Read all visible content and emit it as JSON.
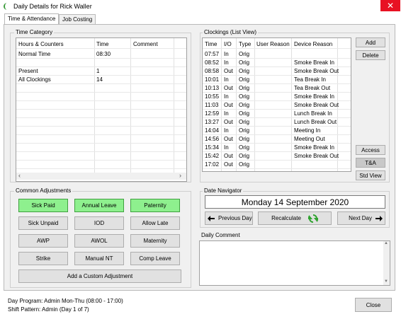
{
  "window": {
    "title": "Daily Details for Rick Waller",
    "close_symbol": "✕"
  },
  "tabs": [
    {
      "label": "Time & Attendance",
      "active": true
    },
    {
      "label": "Job Costing",
      "active": false
    }
  ],
  "time_category": {
    "title": "Time Category",
    "columns": [
      "Hours & Counters",
      "Time",
      "Comment"
    ],
    "rows": [
      {
        "name": "Normal Time",
        "time": "08:30",
        "comment": ""
      },
      {
        "name": "",
        "time": "",
        "comment": ""
      },
      {
        "name": "Present",
        "time": "1",
        "comment": ""
      },
      {
        "name": "All Clockings",
        "time": "14",
        "comment": ""
      }
    ]
  },
  "clockings": {
    "title": "Clockings (List View)",
    "columns": [
      "Time",
      "I/O",
      "Type",
      "User Reason",
      "Device Reason"
    ],
    "rows": [
      {
        "time": "07:57",
        "io": "In",
        "type": "Orig",
        "user_reason": "",
        "device_reason": ""
      },
      {
        "time": "08:52",
        "io": "In",
        "type": "Orig",
        "user_reason": "",
        "device_reason": "Smoke Break In"
      },
      {
        "time": "08:58",
        "io": "Out",
        "type": "Orig",
        "user_reason": "",
        "device_reason": "Smoke Break Out"
      },
      {
        "time": "10:01",
        "io": "In",
        "type": "Orig",
        "user_reason": "",
        "device_reason": "Tea Break In"
      },
      {
        "time": "10:13",
        "io": "Out",
        "type": "Orig",
        "user_reason": "",
        "device_reason": "Tea Break Out"
      },
      {
        "time": "10:55",
        "io": "In",
        "type": "Orig",
        "user_reason": "",
        "device_reason": "Smoke Break In"
      },
      {
        "time": "11:03",
        "io": "Out",
        "type": "Orig",
        "user_reason": "",
        "device_reason": "Smoke Break Out"
      },
      {
        "time": "12:59",
        "io": "In",
        "type": "Orig",
        "user_reason": "",
        "device_reason": "Lunch Break In"
      },
      {
        "time": "13:27",
        "io": "Out",
        "type": "Orig",
        "user_reason": "",
        "device_reason": "Lunch Break Out"
      },
      {
        "time": "14:04",
        "io": "In",
        "type": "Orig",
        "user_reason": "",
        "device_reason": "Meeting In"
      },
      {
        "time": "14:56",
        "io": "Out",
        "type": "Orig",
        "user_reason": "",
        "device_reason": "Meeting Out"
      },
      {
        "time": "15:34",
        "io": "In",
        "type": "Orig",
        "user_reason": "",
        "device_reason": "Smoke Break In"
      },
      {
        "time": "15:42",
        "io": "Out",
        "type": "Orig",
        "user_reason": "",
        "device_reason": "Smoke Break Out"
      },
      {
        "time": "17:02",
        "io": "Out",
        "type": "Orig",
        "user_reason": "",
        "device_reason": ""
      }
    ],
    "buttons": {
      "add": "Add",
      "delete": "Delete",
      "access": "Access",
      "ta": "T&A",
      "std_view": "Std View"
    }
  },
  "common_adjustments": {
    "title": "Common Adjustments",
    "buttons": [
      {
        "label": "Sick Paid",
        "highlight": true
      },
      {
        "label": "Annual Leave",
        "highlight": true
      },
      {
        "label": "Paternity",
        "highlight": true
      },
      {
        "label": "Sick Unpaid",
        "highlight": false
      },
      {
        "label": "IOD",
        "highlight": false
      },
      {
        "label": "Allow Late",
        "highlight": false
      },
      {
        "label": "AWP",
        "highlight": false
      },
      {
        "label": "AWOL",
        "highlight": false
      },
      {
        "label": "Maternity",
        "highlight": false
      },
      {
        "label": "Strike",
        "highlight": false
      },
      {
        "label": "Manual NT",
        "highlight": false
      },
      {
        "label": "Comp Leave",
        "highlight": false
      }
    ],
    "custom_label": "Add a Custom Adjustment"
  },
  "date_navigator": {
    "title": "Date Navigator",
    "date": "Monday 14 September 2020",
    "previous_label": "Previous Day",
    "recalculate_label": "Recalculate",
    "next_label": "Next Day"
  },
  "daily_comment": {
    "title": "Daily Comment",
    "value": ""
  },
  "footer": {
    "day_program": "Day Program:  Admin Mon-Thu  (08:00 - 17:00)",
    "shift_pattern": "Shift Pattern:  Admin  (Day 1 of 7)",
    "close_label": "Close"
  },
  "colors": {
    "highlight_green": "#8ef08e",
    "close_red": "#e81123"
  }
}
